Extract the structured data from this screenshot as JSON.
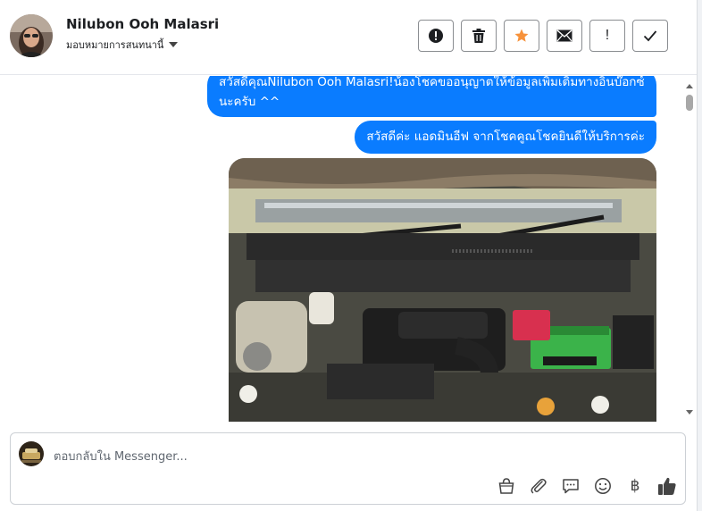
{
  "header": {
    "contact_name": "Nilubon Ooh Malasri",
    "assign_label": "มอบหมายการสนทนานี้",
    "actions": [
      {
        "icon": "alert-circle-icon"
      },
      {
        "icon": "trash-icon"
      },
      {
        "icon": "star-icon",
        "color": "#f7923b"
      },
      {
        "icon": "envelope-icon"
      },
      {
        "icon": "exclamation-icon",
        "label": "!"
      },
      {
        "icon": "checkmark-icon"
      }
    ]
  },
  "messages": [
    {
      "sender": "page",
      "text": "สวัสดีคุณNilubon Ooh Malasri!น้องโชคขออนุญาตให้ข้อมูลเพิ่มเติมทางอินบ๊อกซ์นะครับ ^^"
    },
    {
      "sender": "page",
      "text": "สวัสดีค่ะ แอดมินอีฟ จากโชคคูณโชคยินดีให้บริการค่ะ"
    },
    {
      "sender": "page",
      "type": "image",
      "image": "car-engine-bay-photo"
    }
  ],
  "composer": {
    "placeholder": "ตอบกลับใน Messenger...",
    "baht_symbol": "฿",
    "tools": [
      "shopping-bag-icon",
      "paperclip-icon",
      "saved-replies-icon",
      "emoji-icon",
      "baht-icon",
      "thumbs-up-icon"
    ]
  },
  "colors": {
    "bubble": "#0a7cff",
    "accent_star": "#f7923b"
  }
}
